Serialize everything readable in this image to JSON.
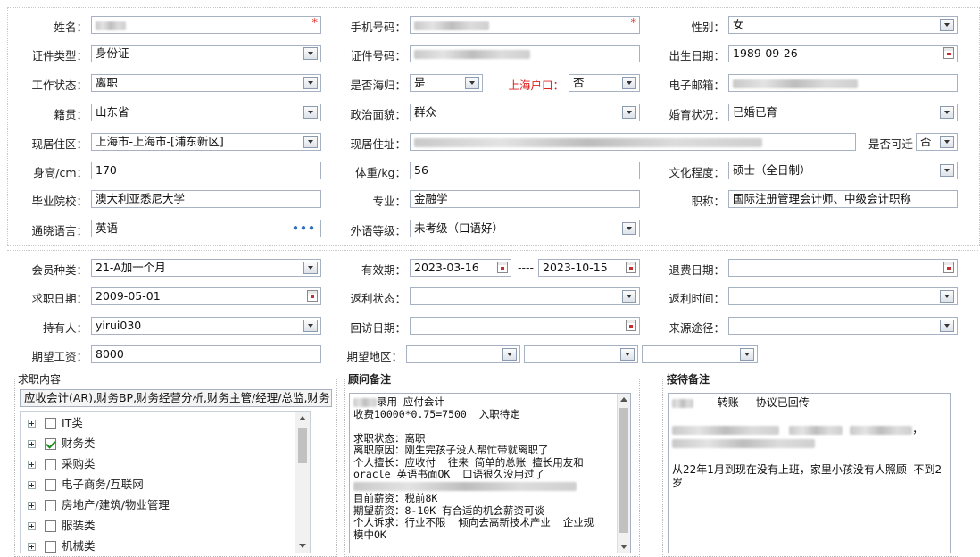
{
  "form": {
    "name": {
      "label": "姓名：",
      "required": "*"
    },
    "phone": {
      "label": "手机号码：",
      "required": "*"
    },
    "gender": {
      "label": "性别：",
      "value": "女"
    },
    "id_type": {
      "label": "证件类型：",
      "value": "身份证"
    },
    "id_number": {
      "label": "证件号码："
    },
    "birthdate": {
      "label": "出生日期：",
      "value": "1989-09-26"
    },
    "work_status": {
      "label": "工作状态：",
      "value": "离职"
    },
    "returnee": {
      "label": "是否海归：",
      "value": "是"
    },
    "shanghai_hukou": {
      "label": "上海户口：",
      "value": "否"
    },
    "email": {
      "label": "电子邮箱："
    },
    "native_place": {
      "label": "籍贯：",
      "value": "山东省"
    },
    "political": {
      "label": "政治面貌：",
      "value": "群众"
    },
    "marital": {
      "label": "婚育状况：",
      "value": "已婚已育"
    },
    "residence_area": {
      "label": "现居住区：",
      "value": "上海市-上海市-[浦东新区]"
    },
    "address": {
      "label": "现居住址："
    },
    "relocatable": {
      "label": "是否可迁",
      "value": "否"
    },
    "height": {
      "label": "身高/cm：",
      "value": "170"
    },
    "weight": {
      "label": "体重/kg：",
      "value": "56"
    },
    "education": {
      "label": "文化程度：",
      "value": "硕士（全日制）"
    },
    "school": {
      "label": "毕业院校：",
      "value": "澳大利亚悉尼大学"
    },
    "major": {
      "label": "专业：",
      "value": "金融学"
    },
    "title": {
      "label": "职称：",
      "value": "国际注册管理会计师、中级会计职称"
    },
    "language": {
      "label": "通晓语言：",
      "value": "英语",
      "more": "•••"
    },
    "language_level": {
      "label": "外语等级：",
      "value": "未考级（口语好）"
    }
  },
  "membership": {
    "member_type": {
      "label": "会员种类：",
      "value": "21-A加一个月"
    },
    "validity": {
      "label": "有效期：",
      "start": "2023-03-16",
      "separator": "----",
      "end": "2023-10-15"
    },
    "refund_date": {
      "label": "退费日期：",
      "value": ""
    },
    "job_date": {
      "label": "求职日期：",
      "value": "2009-05-01"
    },
    "rebate_status": {
      "label": "返利状态：",
      "value": ""
    },
    "rebate_time": {
      "label": "返利时间：",
      "value": ""
    },
    "holder": {
      "label": "持有人：",
      "value": "yirui030"
    },
    "visit_date": {
      "label": "回访日期：",
      "value": ""
    },
    "source": {
      "label": "来源途径：",
      "value": ""
    },
    "expected_salary": {
      "label": "期望工资：",
      "value": "8000"
    },
    "expected_region": {
      "label": "期望地区：",
      "value": ""
    }
  },
  "job_content": {
    "title": "求职内容",
    "selected": "应收会计(AR),财务BP,财务经营分析,财务主管/经理/总监,财务",
    "tree": [
      {
        "label": "IT类",
        "checked": false
      },
      {
        "label": "财务类",
        "checked": true
      },
      {
        "label": "采购类",
        "checked": false
      },
      {
        "label": "电子商务/互联网",
        "checked": false
      },
      {
        "label": "房地产/建筑/物业管理",
        "checked": false
      },
      {
        "label": "服装类",
        "checked": false
      },
      {
        "label": "机械类",
        "checked": false
      }
    ]
  },
  "consultant_notes": {
    "title": "顾问备注",
    "line1": "录用 应付会计",
    "line2": "收费10000*0.75=7500  入职待定",
    "line3": "求职状态：离职",
    "line4": "离职原因：刚生完孩子没人帮忙带就离职了",
    "line5": "个人擅长：应收付  往来 简单的总账 擅长用友和",
    "line6": "oracle 英语书面OK  口语很久没用过了",
    "line7": "目前薪资：税前8K",
    "line8": "期望薪资：8-10K 有合适的机会薪资可谈",
    "line9": "个人诉求：行业不限  倾向去高新技术产业  企业规",
    "line10": "模中OK"
  },
  "reception_notes": {
    "title": "接待备注",
    "line1_a": "转账",
    "line1_b": "协议已回传",
    "line2_tail": "，",
    "line3": "从22年1月到现在没有上班，家里小孩没有人照顾  不到2岁"
  }
}
